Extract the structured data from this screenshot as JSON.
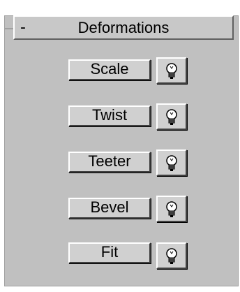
{
  "rollout": {
    "collapse_symbol": "-",
    "title": "Deformations"
  },
  "deformations": [
    {
      "label": "Scale",
      "icon": "lightbulb-icon"
    },
    {
      "label": "Twist",
      "icon": "lightbulb-icon"
    },
    {
      "label": "Teeter",
      "icon": "lightbulb-icon"
    },
    {
      "label": "Bevel",
      "icon": "lightbulb-icon"
    },
    {
      "label": "Fit",
      "icon": "lightbulb-icon"
    }
  ],
  "colors": {
    "panel_bg": "#c0c0c0",
    "button_face": "#d0d0d0",
    "highlight": "#ffffff",
    "shadow": "#404040"
  }
}
